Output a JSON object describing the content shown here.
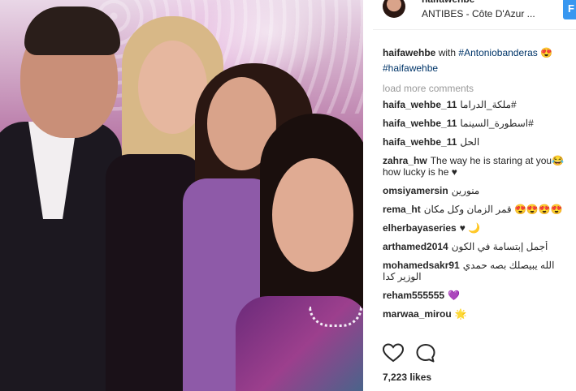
{
  "header": {
    "username": "haifawehbe",
    "location": "ANTIBES - Côte D'Azur ...",
    "follow_label": "F"
  },
  "caption": {
    "username": "haifawehbe",
    "text_before": "with",
    "mention": "#Antoniobanderas",
    "emoji": "😍",
    "hashtag": "#haifawehbe"
  },
  "load_more": "load more comments",
  "comments": [
    {
      "user": "haifa_wehbe_11",
      "text": "ملكة_الدراما#"
    },
    {
      "user": "haifa_wehbe_11",
      "text": "اسطورة_السينما#"
    },
    {
      "user": "haifa_wehbe_11",
      "text": "الحل"
    },
    {
      "user": "zahra_hw",
      "text": "The way he is staring at you😂 how lucky is he ♥"
    },
    {
      "user": "omsiyamersin",
      "text": "منورين"
    },
    {
      "user": "rema_ht",
      "text": "قمر الزمان وكل مكان 😍😍😍😍"
    },
    {
      "user": "elherbayaseries",
      "text": "♥ 🌙"
    },
    {
      "user": "arthamed2014",
      "text": "أجمل إبتسامة في الكون"
    },
    {
      "user": "mohamedsakr91",
      "text": "الله يبيصلك بصه حمدي الوزير كدا"
    },
    {
      "user": "reham555555",
      "text": "💜"
    },
    {
      "user": "marwaa_mirou",
      "text": "🌟"
    }
  ],
  "likes": "7,223 likes",
  "icons": {
    "like": "heart-outline-icon",
    "comment": "comment-bubble-icon"
  },
  "colors": {
    "follow_button": "#3897f0",
    "link": "#003569",
    "muted": "#999999"
  }
}
